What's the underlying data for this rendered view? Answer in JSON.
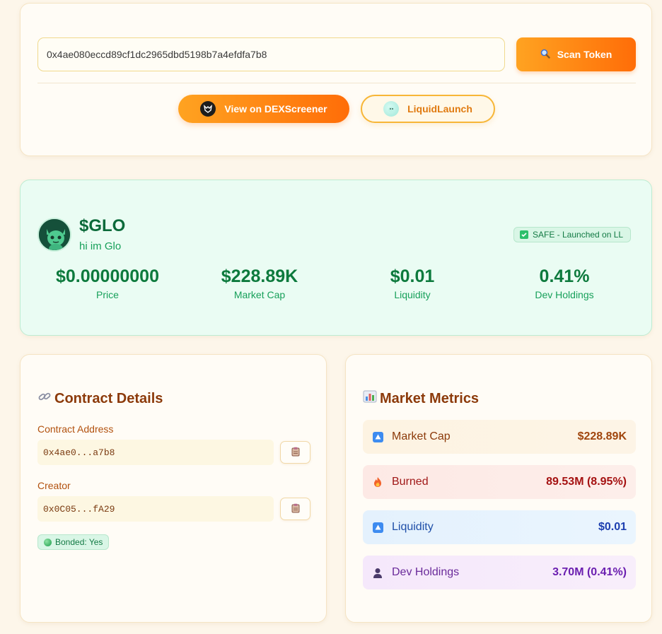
{
  "search": {
    "value": "0x4ae080eccd89cf1dc2965dbd5198b7a4efdfa7b8",
    "scan_label": "Scan Token"
  },
  "links": {
    "dex_label": "View on DEXScreener",
    "ll_label": "LiquidLaunch"
  },
  "token": {
    "symbol": "$GLO",
    "name": "hi im Glo",
    "safe_badge": "SAFE - Launched on LL",
    "stats": [
      {
        "value": "$0.00000000",
        "label": "Price"
      },
      {
        "value": "$228.89K",
        "label": "Market Cap"
      },
      {
        "value": "$0.01",
        "label": "Liquidity"
      },
      {
        "value": "0.41%",
        "label": "Dev Holdings"
      }
    ]
  },
  "contract": {
    "title": "Contract Details",
    "address_label": "Contract Address",
    "address_value": "0x4ae0...a7b8",
    "creator_label": "Creator",
    "creator_value": "0x0C05...fA29",
    "bonded": "Bonded: Yes"
  },
  "market": {
    "title": "Market Metrics",
    "rows": [
      {
        "label": "Market Cap",
        "value": "$228.89K",
        "icon": "up-arrow-icon"
      },
      {
        "label": "Burned",
        "value": "89.53M (8.95%)",
        "icon": "fire-icon"
      },
      {
        "label": "Liquidity",
        "value": "$0.01",
        "icon": "up-arrow-icon"
      },
      {
        "label": "Dev Holdings",
        "value": "3.70M (0.41%)",
        "icon": "person-icon"
      }
    ]
  },
  "colors": {
    "accent_orange": "#ff7a0f",
    "safe_green": "#0d7a3d",
    "page_bg": "#fdf6ea"
  }
}
